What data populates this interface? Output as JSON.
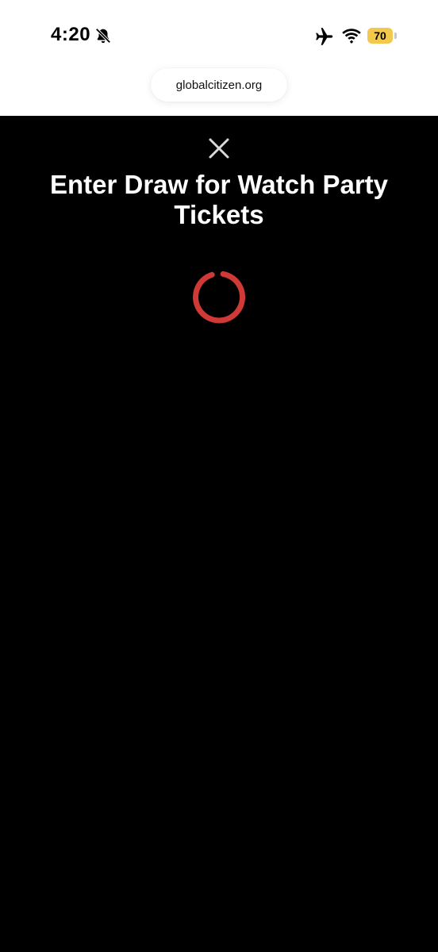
{
  "status_bar": {
    "time": "4:20",
    "battery_level": "70",
    "icons": [
      "bell-slash-icon",
      "airplane-icon",
      "wifi-icon",
      "battery-icon"
    ],
    "battery_color": "#f2c94c"
  },
  "browser": {
    "url": "globalcitizen.org"
  },
  "modal": {
    "close_icon": "close-icon",
    "title": "Enter Draw for Watch Party Tickets",
    "spinner_color": "#d03a36",
    "background_color": "#000000"
  }
}
